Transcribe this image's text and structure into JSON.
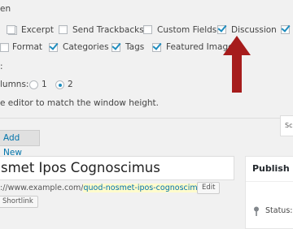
{
  "screen_options": {
    "heading_partial": "en",
    "boxes_row1": [
      {
        "label": "Excerpt",
        "checked": false
      },
      {
        "label": "Send Trackbacks",
        "checked": false
      },
      {
        "label": "Custom Fields",
        "checked": false
      },
      {
        "label": "Discussion",
        "checked": true
      },
      {
        "label": "",
        "checked": true
      }
    ],
    "boxes_row2": [
      {
        "label": "Format",
        "checked": false
      },
      {
        "label": "Categories",
        "checked": true
      },
      {
        "label": "Tags",
        "checked": true
      },
      {
        "label": "Featured Image",
        "checked": true
      }
    ],
    "layout_label_partial": ":",
    "columns_label_partial": "lumns:",
    "column_options": [
      "1",
      "2"
    ],
    "selected_column": "2",
    "expand_text_partial": "e editor to match the window height.",
    "annotation_color": "#a61c1c"
  },
  "toolbar": {
    "add_new_label": "Add New",
    "screen_options_tab_partial": "Sc"
  },
  "editor": {
    "title_value": "smet Ipos Cognoscimus",
    "permalink_prefix": "://www.example.com/",
    "permalink_slug": "quod-nosmet-ipos-cognoscimus/",
    "edit_button_label": "Edit",
    "shortlink_button_label": "Shortlink"
  },
  "publish": {
    "title": "Publish",
    "status_label": "Status: I"
  }
}
